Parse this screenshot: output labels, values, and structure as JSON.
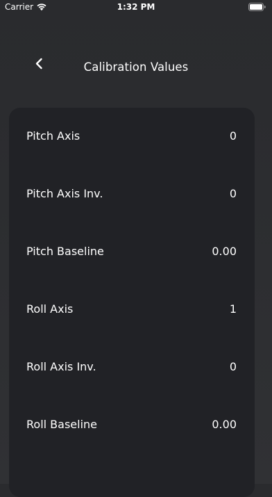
{
  "status_bar": {
    "carrier": "Carrier",
    "time": "1:32 PM",
    "wifi_icon": "wifi-icon",
    "battery_icon": "battery-icon"
  },
  "nav": {
    "back_icon": "chevron-left-icon",
    "title": "Calibration Values"
  },
  "rows": [
    {
      "label": "Pitch Axis",
      "value": "0"
    },
    {
      "label": "Pitch Axis Inv.",
      "value": "0"
    },
    {
      "label": "Pitch Baseline",
      "value": "0.00"
    },
    {
      "label": "Roll Axis",
      "value": "1"
    },
    {
      "label": "Roll Axis Inv.",
      "value": "0"
    },
    {
      "label": "Roll Baseline",
      "value": "0.00"
    }
  ]
}
